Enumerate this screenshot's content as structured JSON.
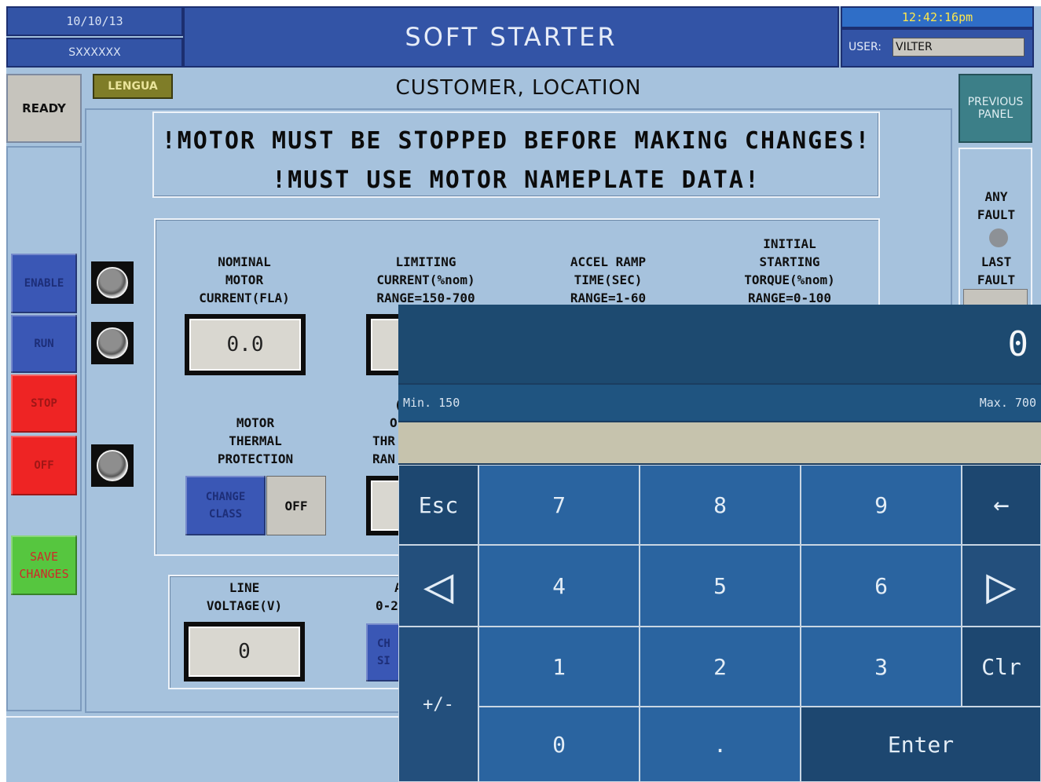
{
  "header": {
    "date": "10/10/13",
    "serial": "SXXXXXX",
    "title": "SOFT STARTER",
    "time": "12:42:16pm",
    "user_label": "USER:",
    "user_value": "VILTER"
  },
  "status": {
    "ready": "READY"
  },
  "language_button": "LENGUA",
  "location": "CUSTOMER, LOCATION",
  "warnings": {
    "line1": "!MOTOR MUST BE STOPPED BEFORE MAKING CHANGES!",
    "line2": "!MUST USE MOTOR NAMEPLATE DATA!"
  },
  "left_buttons": {
    "enable": "ENABLE",
    "run": "RUN",
    "stop": "STOP",
    "off": "OFF",
    "save_l1": "SAVE",
    "save_l2": "CHANGES"
  },
  "params": {
    "nominal": {
      "l1": "NOMINAL",
      "l2": "MOTOR",
      "l3": "CURRENT(FLA)",
      "value": "0.0"
    },
    "limiting": {
      "l1": "LIMITING",
      "l2": "CURRENT(%nom)",
      "l3": "RANGE=150-700"
    },
    "accel": {
      "l1": "ACCEL RAMP",
      "l2": "TIME(SEC)",
      "l3": "RANGE=1-60"
    },
    "initial": {
      "l1": "INITIAL",
      "l2": "STARTING",
      "l3": "TORQUE(%nom)",
      "l4": "RANGE=0-100"
    },
    "thermal": {
      "l1": "MOTOR",
      "l2": "THERMAL",
      "l3": "PROTECTION",
      "change_l1": "CHANGE",
      "change_l2": "CLASS",
      "state": "OFF"
    },
    "over": {
      "l1": "(",
      "l2": "O",
      "l3": "THR",
      "l4": "RAN"
    },
    "line_voltage": {
      "l1": "LINE",
      "l2": "VOLTAGE(V)",
      "value": "0"
    },
    "aux": {
      "l1": "A",
      "l2": "0-2",
      "btn_l1": "CH",
      "btn_l2": "SI"
    }
  },
  "right_panel": {
    "previous_l1": "PREVIOUS",
    "previous_l2": "PANEL",
    "any_fault_l1": "ANY",
    "any_fault_l2": "FAULT",
    "last_fault_l1": "LAST",
    "last_fault_l2": "FAULT"
  },
  "keypad": {
    "display": "0",
    "min": "Min. 150",
    "max": "Max. 700",
    "keys": {
      "esc": "Esc",
      "k7": "7",
      "k8": "8",
      "k9": "9",
      "backspace": "←",
      "left": "◁",
      "k4": "4",
      "k5": "5",
      "k6": "6",
      "right": "▷",
      "sign": "+/-",
      "k1": "1",
      "k2": "2",
      "k3": "3",
      "clr": "Clr",
      "k0": "0",
      "dot": ".",
      "enter": "Enter"
    }
  }
}
